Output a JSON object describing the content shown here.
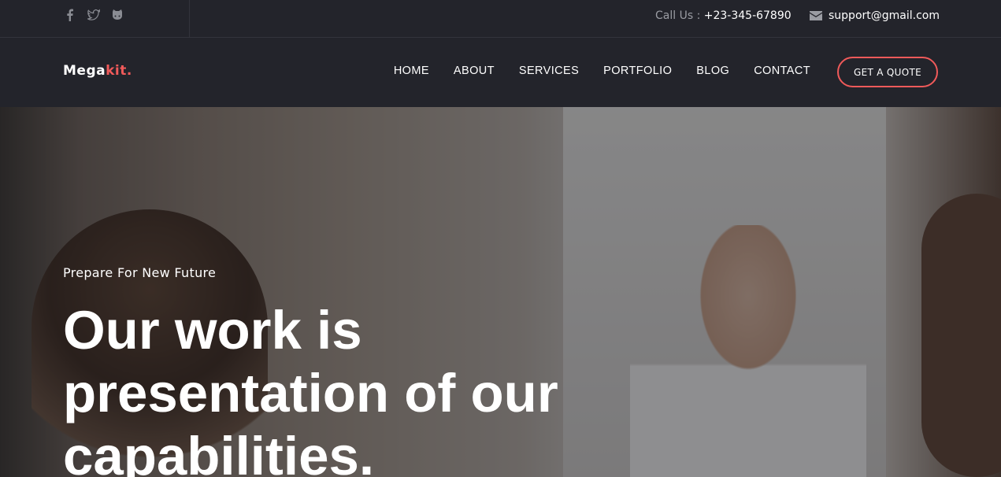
{
  "topbar": {
    "social": [
      {
        "icon": "facebook-icon"
      },
      {
        "icon": "twitter-icon"
      },
      {
        "icon": "github-icon"
      }
    ],
    "call_label": "Call Us :",
    "call_number": "+23-345-67890",
    "email": "support@gmail.com"
  },
  "navbar": {
    "logo_primary": "Mega",
    "logo_accent": "kit.",
    "menu": [
      "HOME",
      "ABOUT",
      "SERVICES",
      "PORTFOLIO",
      "BLOG",
      "CONTACT"
    ],
    "cta_label": "GET A QUOTE"
  },
  "hero": {
    "subtitle": "Prepare For New Future",
    "headline": "Our work is presentation of our capabilities."
  },
  "colors": {
    "accent": "#f05a5a",
    "bar_background": "#23242b"
  }
}
